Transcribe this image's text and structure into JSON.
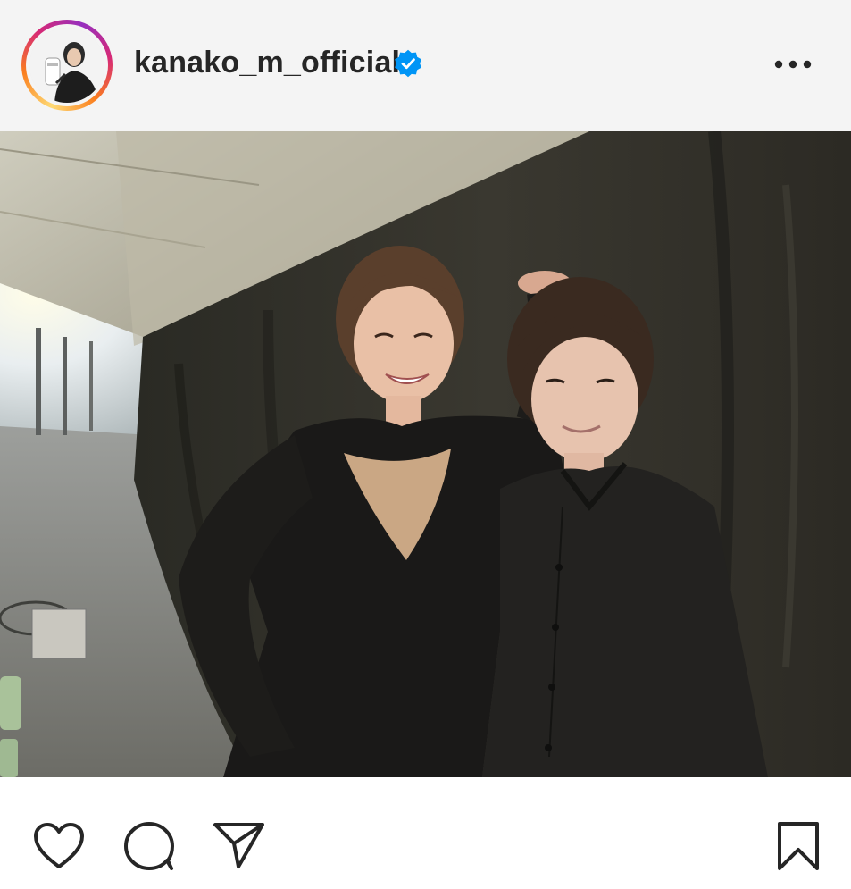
{
  "post": {
    "author": {
      "username": "kanako_m_official",
      "verified": true,
      "avatar_icon": "profile-photo",
      "story_ring_colors": [
        "#feda75",
        "#fa7e1e",
        "#d62976",
        "#962fbf"
      ]
    },
    "menu_icon": "more-horizontal-icon",
    "photo": {
      "alt": "Two people posing backstage in front of a dark curtain"
    },
    "actions": {
      "like_icon": "heart-icon",
      "comment_icon": "comment-icon",
      "share_icon": "send-icon",
      "save_icon": "bookmark-icon"
    }
  },
  "colors": {
    "header_bg": "#f4f4f4",
    "text": "#262626",
    "verified_blue": "#0095f6",
    "icon": "#262626"
  }
}
